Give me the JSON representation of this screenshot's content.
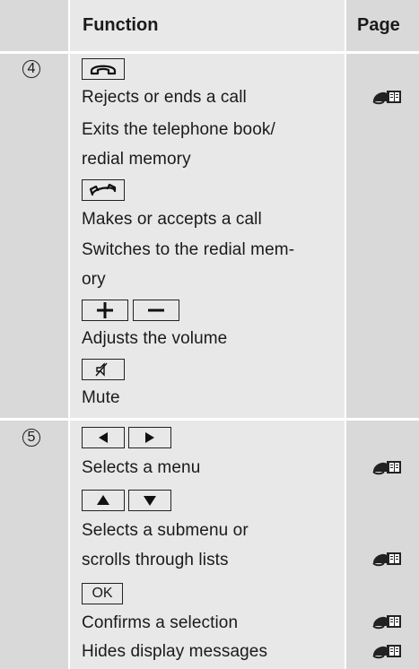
{
  "header": {
    "function": "Function",
    "page": "Page"
  },
  "rows": [
    {
      "number": "4",
      "lines": {
        "rejects": "Rejects or ends a call",
        "exits_1": "Exits the telephone book/",
        "exits_2": "redial memory",
        "makes": "Makes or accepts a call",
        "switches_1": "Switches to the redial mem-",
        "switches_2": "ory",
        "adjusts": "Adjusts the volume",
        "mute": "Mute"
      }
    },
    {
      "number": "5",
      "lines": {
        "selects_menu": "Selects a menu",
        "submenu_1": "Selects a submenu or",
        "submenu_2": "scrolls through lists",
        "ok_key": "OK",
        "confirms": "Confirms a selection",
        "hides": "Hides display messages"
      }
    }
  ],
  "icons": {
    "end_call": "end-call-key",
    "accept_call": "accept-call-key",
    "plus": "plus-key",
    "minus": "minus-key",
    "mute": "mute-key",
    "left": "left-arrow-key",
    "right": "right-arrow-key",
    "up": "up-arrow-key",
    "down": "down-arrow-key",
    "page_ref": "steering-wheel-book-icon"
  }
}
